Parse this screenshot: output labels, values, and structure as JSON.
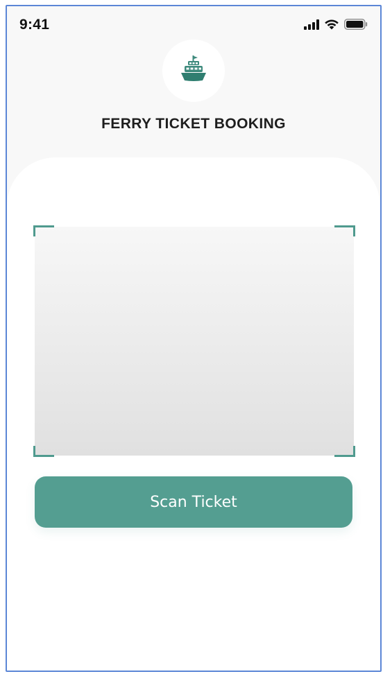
{
  "status_bar": {
    "time": "9:41",
    "icons": [
      "cellular-signal-icon",
      "wifi-icon",
      "battery-icon"
    ]
  },
  "header": {
    "logo_icon": "ferry-icon",
    "title": "FERRY TICKET BOOKING"
  },
  "scanner": {
    "frame_color": "#4f9a8e"
  },
  "actions": {
    "scan_label": "Scan Ticket"
  },
  "colors": {
    "accent": "#549e91",
    "background": "#f8f8f8",
    "card": "#ffffff",
    "title_text": "#1e1e1e"
  }
}
